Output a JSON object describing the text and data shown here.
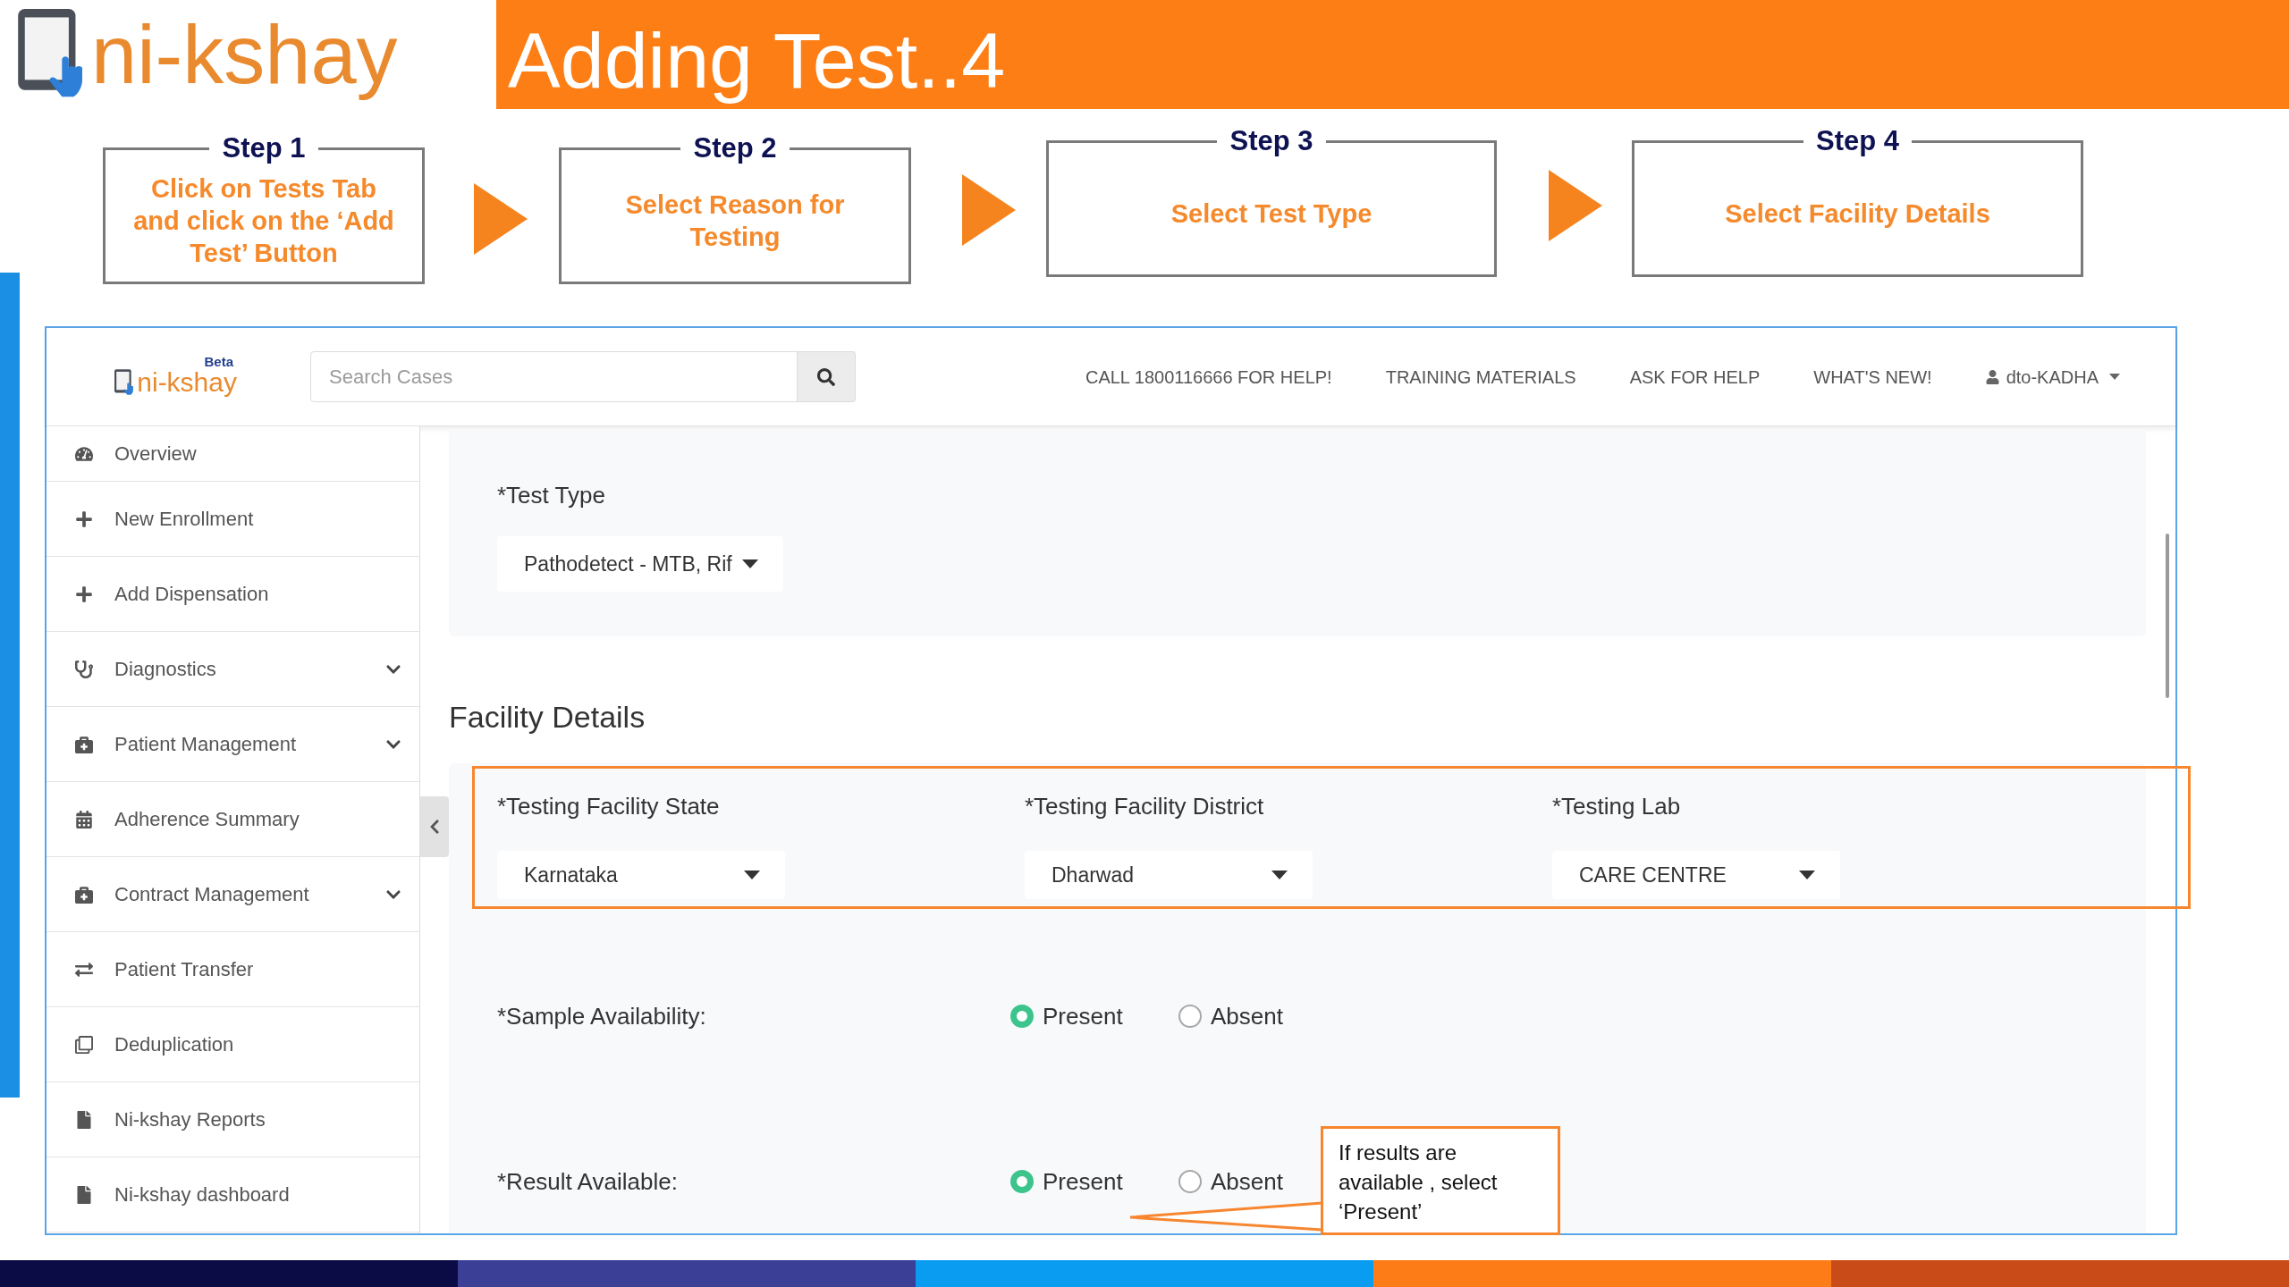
{
  "brand": {
    "name": "ni-kshay"
  },
  "title": "Adding Test..4",
  "steps": [
    {
      "label": "Step 1",
      "text": "Click on Tests Tab and click on the ‘Add Test’ Button"
    },
    {
      "label": "Step 2",
      "text": "Select Reason for Testing"
    },
    {
      "label": "Step 3",
      "text": "Select Test Type"
    },
    {
      "label": "Step 4",
      "text": "Select Facility Details"
    }
  ],
  "app": {
    "navbar": {
      "logo_text": "ni-kshay",
      "logo_badge": "Beta",
      "search": {
        "placeholder": "Search Cases"
      },
      "links": [
        "CALL 1800116666 FOR HELP!",
        "TRAINING MATERIALS",
        "ASK FOR HELP",
        "WHAT'S NEW!"
      ],
      "user": "dto-KADHA"
    },
    "sidebar": {
      "items": [
        {
          "label": "Overview",
          "kind": "link"
        },
        {
          "label": "New Enrollment",
          "kind": "link"
        },
        {
          "label": "Add Dispensation",
          "kind": "link"
        },
        {
          "label": "Diagnostics",
          "kind": "menu"
        },
        {
          "label": "Patient Management",
          "kind": "menu"
        },
        {
          "label": "Adherence Summary",
          "kind": "link"
        },
        {
          "label": "Contract Management",
          "kind": "menu"
        },
        {
          "label": "Patient Transfer",
          "kind": "link"
        },
        {
          "label": "Deduplication",
          "kind": "link"
        },
        {
          "label": "Ni-kshay Reports",
          "kind": "link"
        },
        {
          "label": "Ni-kshay dashboard",
          "kind": "link"
        }
      ]
    },
    "test_type": {
      "label": "*Test Type",
      "value": "Pathodetect - MTB, Rif"
    },
    "facility_details": {
      "heading": "Facility Details",
      "fields": [
        {
          "label": "*Testing Facility State",
          "value": "Karnataka"
        },
        {
          "label": "*Testing Facility District",
          "value": "Dharwad"
        },
        {
          "label": "*Testing Lab",
          "value": "CARE CENTRE"
        }
      ]
    },
    "questions": [
      {
        "label": "*Sample Availability:",
        "options": [
          {
            "label": "Present",
            "selected": true
          },
          {
            "label": "Absent",
            "selected": false
          }
        ]
      },
      {
        "label": "*Result Available:",
        "options": [
          {
            "label": "Present",
            "selected": true
          },
          {
            "label": "Absent",
            "selected": false
          }
        ]
      }
    ]
  },
  "callout": {
    "text": "If results are available , select ‘Present’"
  }
}
